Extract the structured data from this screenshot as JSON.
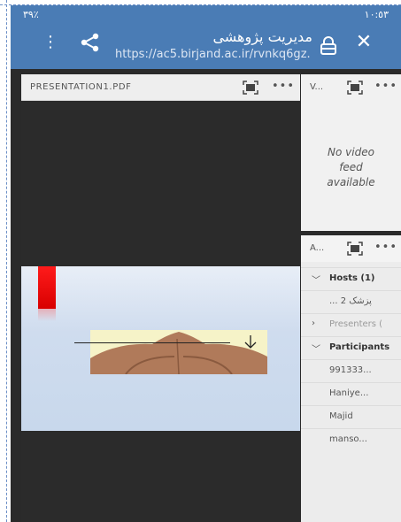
{
  "status_bar": {
    "left": "٣٩٪ ",
    "right": "١٠:٥٣"
  },
  "header": {
    "title": "مدیریت پژوهشی",
    "url": "https://ac5.birjand.ac.ir/rvnkq6gz...",
    "icons": [
      "more-vert-icon",
      "share-icon",
      "lock-icon",
      "close-icon"
    ]
  },
  "presentation": {
    "title": "PRESENTATION1.PDF",
    "more_label": "•••"
  },
  "video_pod": {
    "title": "V...",
    "more_label": "•••",
    "message_line1": "No video",
    "message_line2": "feed",
    "message_line3": "available"
  },
  "attendees": {
    "title": "A...",
    "more_label": "•••",
    "hosts_label": "Hosts (1)",
    "host_name": "... پزشک 2",
    "presenters_label": "Presenters (",
    "participants_label": "Participants",
    "participants": [
      "991333...",
      "Haniye...",
      "Majid",
      "manso..."
    ]
  },
  "colors": {
    "header_bg": "#4a7cb5",
    "accent_red": "#ff1b1b"
  }
}
